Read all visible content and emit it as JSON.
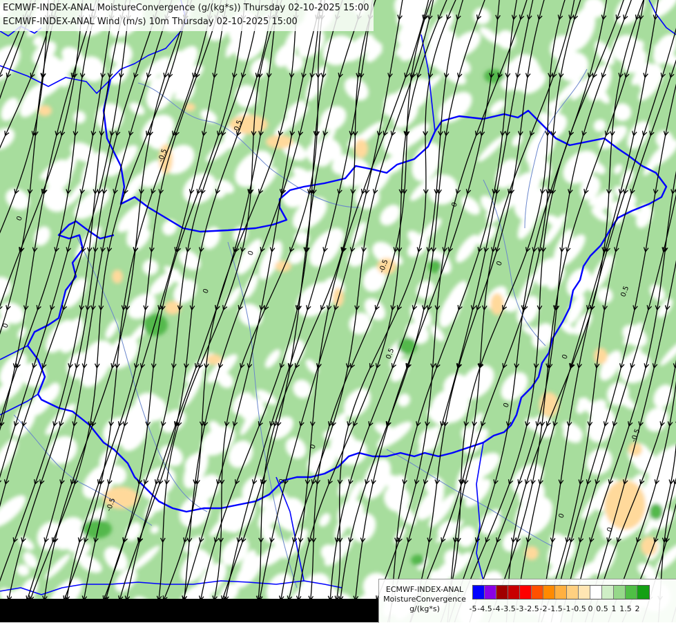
{
  "title": {
    "line1": "ECMWF-INDEX-ANAL MoistureConvergence (g/(kg*s)) Thursday 02-10-2025 15:00",
    "line2": "ECMWF-INDEX-ANAL Wind (m/s) 10m Thursday 02-10-2025 15:00"
  },
  "legend": {
    "model": "ECMWF-INDEX-ANAL",
    "parameter": "MoistureConvergence",
    "unit": "g/(kg*s)",
    "ticks": [
      "-5",
      "-4.5",
      "-4",
      "-3.5",
      "-3",
      "-2.5",
      "-2",
      "-1.5",
      "-1",
      "-0.5",
      "0",
      "0.5",
      "1",
      "1.5",
      "2"
    ],
    "colors": [
      "#0000ff",
      "#8a00e6",
      "#a00000",
      "#c80000",
      "#ff0000",
      "#ff5000",
      "#ff8a00",
      "#ffb040",
      "#ffd080",
      "#ffe6b3",
      "#ffffff",
      "#cfeec6",
      "#96d88a",
      "#4fbf45",
      "#14a014"
    ]
  },
  "map_colors": {
    "border": "#0000ff",
    "river": "#5a78c8",
    "streamline": "#000000",
    "contour": "#000000"
  },
  "contour_labels": [
    "0",
    "0.5",
    "-0.5"
  ]
}
